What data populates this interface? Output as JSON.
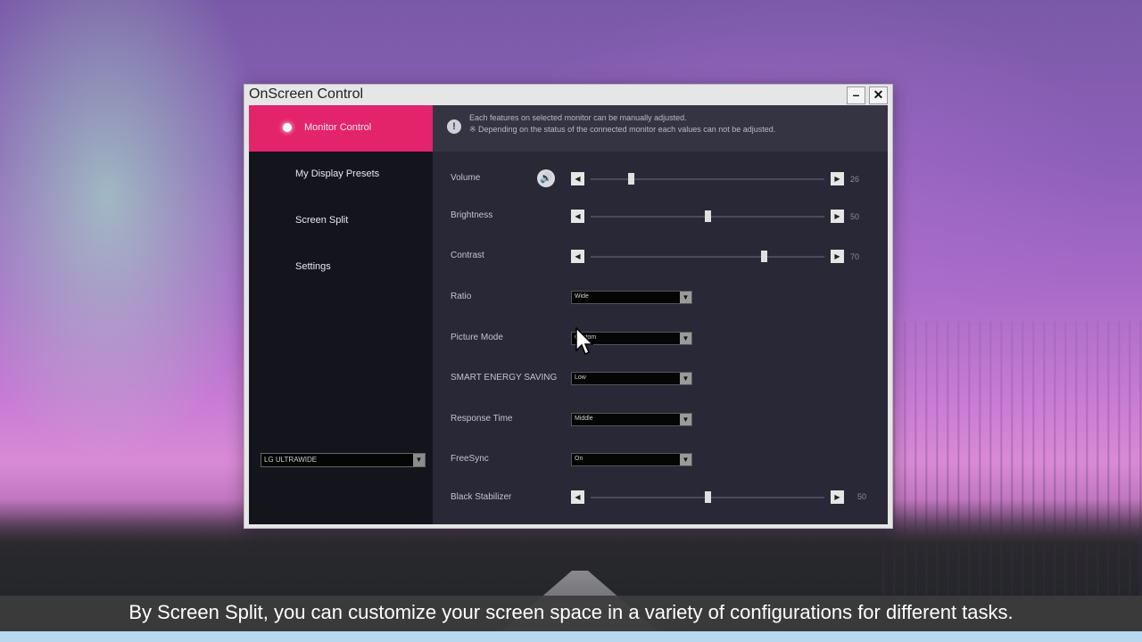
{
  "window": {
    "title": "OnScreen Control",
    "minimize_label": "–",
    "close_label": "✕"
  },
  "sidebar": {
    "items": [
      {
        "label": "Monitor Control",
        "active": true
      },
      {
        "label": "My Display Presets",
        "active": false
      },
      {
        "label": "Screen Split",
        "active": false
      },
      {
        "label": "Settings",
        "active": false
      }
    ],
    "monitor_select": "LG ULTRAWIDE",
    "accent_color": "#e3246a"
  },
  "info": {
    "line1": "Each features on selected monitor can be manually adjusted.",
    "line2": "※ Depending on the status of the connected monitor each values can not be adjusted."
  },
  "controls": {
    "volume": {
      "label": "Volume",
      "value": "26",
      "level": 0.17
    },
    "brightness": {
      "label": "Brightness",
      "value": "50",
      "level": 0.5
    },
    "contrast": {
      "label": "Contrast",
      "value": "70",
      "level": 0.74
    },
    "ratio": {
      "label": "Ratio",
      "value": "Wide"
    },
    "picture_mode": {
      "label": "Picture Mode",
      "value": "Custom"
    },
    "smart_energy": {
      "label": "SMART ENERGY SAVING",
      "value": "Low"
    },
    "response_time": {
      "label": "Response Time",
      "value": "Middle"
    },
    "freesync": {
      "label": "FreeSync",
      "value": "On"
    },
    "black_stabilizer": {
      "label": "Black Stabilizer",
      "value": "50",
      "level": 0.5
    }
  },
  "icons": {
    "left_arrow": "◀",
    "right_arrow": "▶",
    "dropdown": "▼",
    "speaker": "🔊",
    "info": "!"
  },
  "subtitle": "By Screen Split, you can customize your screen space in a variety of configurations for different tasks."
}
